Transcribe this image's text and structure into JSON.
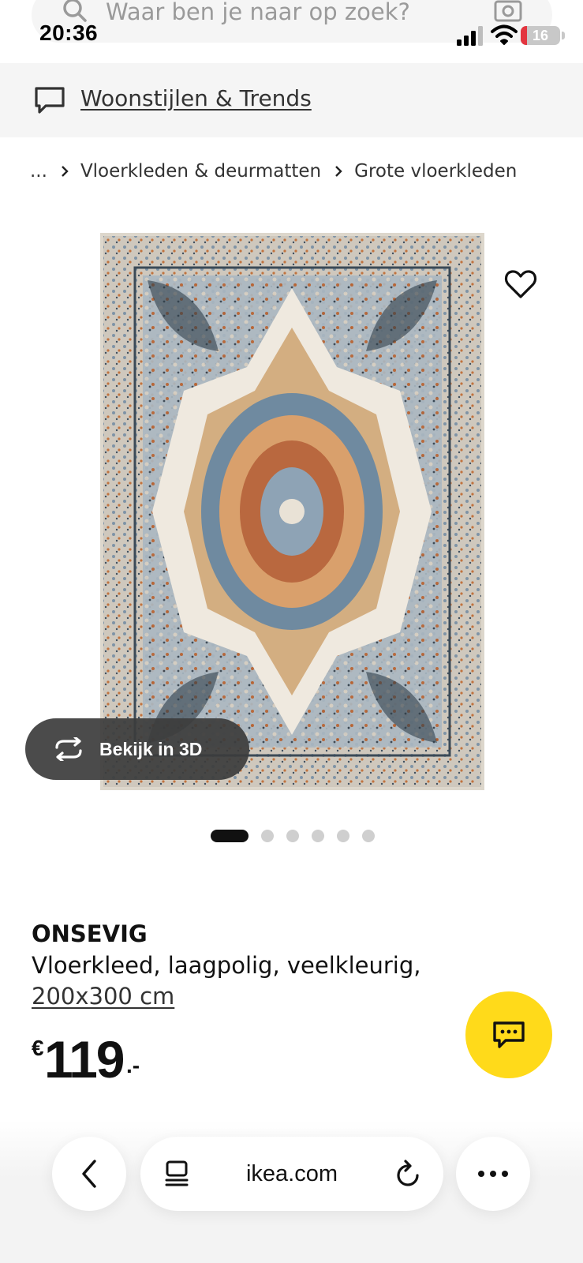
{
  "status_bar": {
    "time": "20:36",
    "battery_level": "16",
    "battery_fraction": 0.16,
    "icons": [
      "signal-icon",
      "wifi-icon",
      "battery-icon"
    ]
  },
  "search": {
    "placeholder": "Waar ben je naar op zoek?",
    "icons": [
      "search-icon",
      "camera-icon"
    ]
  },
  "inspiration": {
    "link_label": "Woonstijlen & Trends",
    "icon": "chat-outline-icon"
  },
  "breadcrumb": {
    "items": [
      "...",
      "Vloerkleden & deurmatten",
      "Grote vloerkleden"
    ]
  },
  "gallery": {
    "view_3d_label": "Bekijk in 3D",
    "image_count": 6,
    "active_index": 0,
    "icons": [
      "heart-icon",
      "rotate-3d-icon"
    ]
  },
  "product": {
    "name": "ONSEVIG",
    "description": "Vloerkleed, laagpolig, veelkleurig,",
    "size": "200x300 cm",
    "price": {
      "currency": "€",
      "amount": "119",
      "suffix": ".-"
    }
  },
  "chat_fab": {
    "icon": "chat-bubble-icon",
    "color": "#ffda1a"
  },
  "browser": {
    "address": "ikea.com",
    "icons": [
      "chevron-left-icon",
      "reader-mode-icon",
      "reload-icon",
      "more-icon"
    ]
  },
  "colors": {
    "brand_yellow": "#ffda1a",
    "strip_background": "#f5f5f5",
    "text_primary": "#111111",
    "battery_low": "#e3353f"
  }
}
